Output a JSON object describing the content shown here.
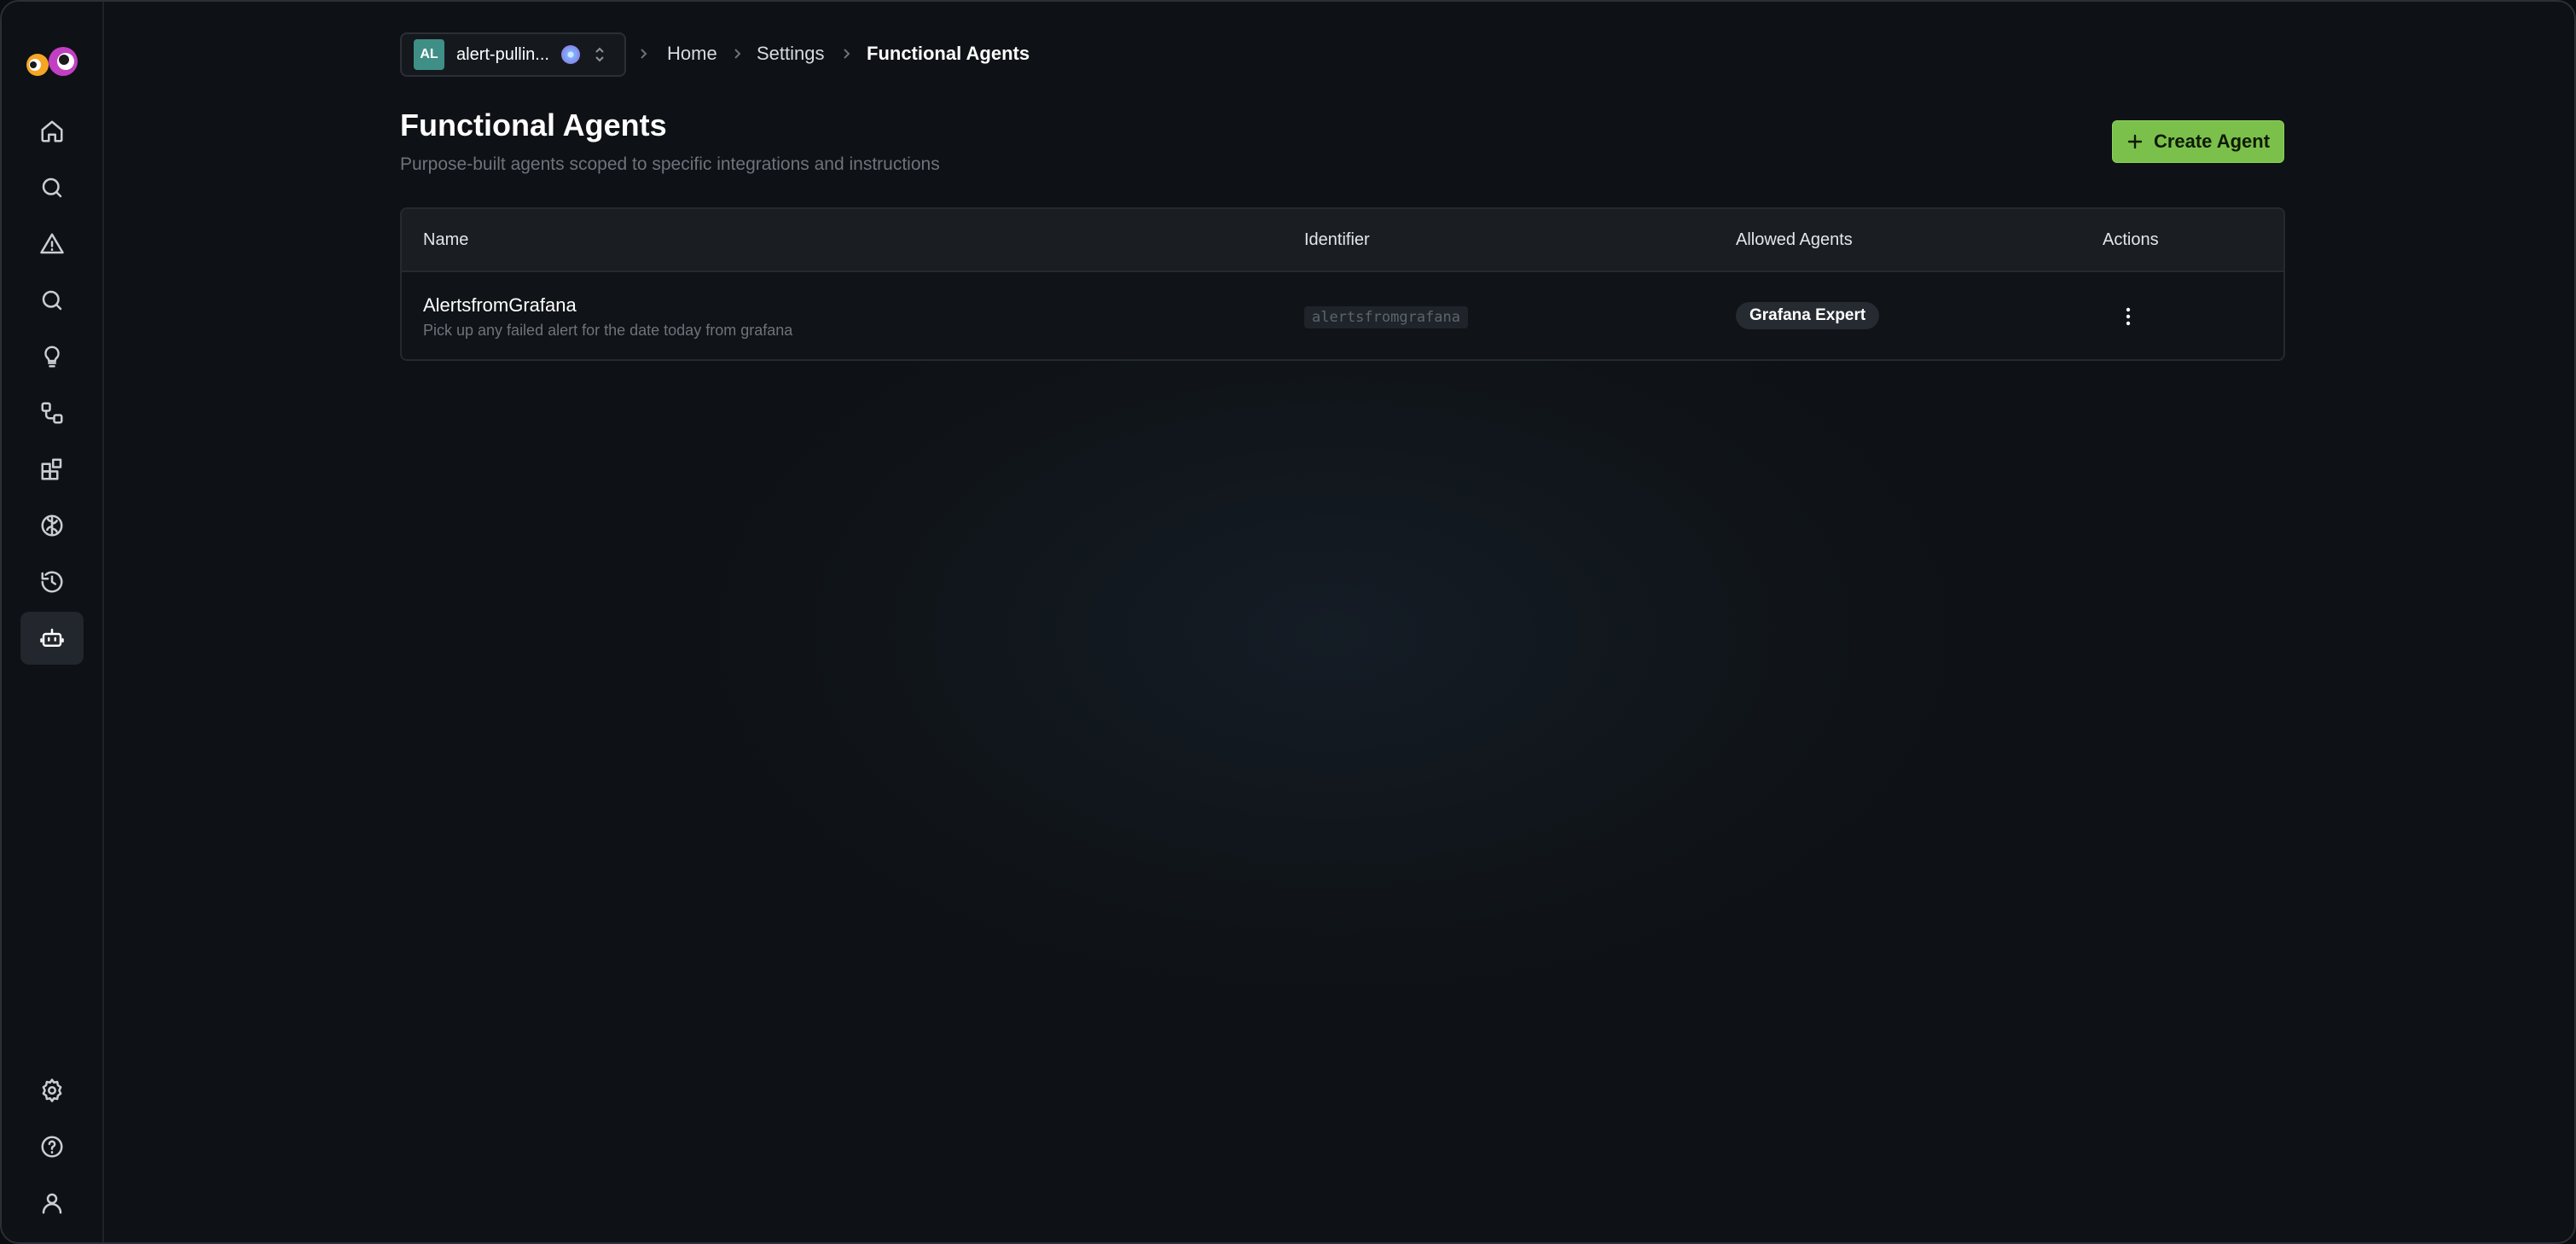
{
  "workspace": {
    "badge": "AL",
    "name": "alert-pullin..."
  },
  "breadcrumb": {
    "home": "Home",
    "settings": "Settings",
    "current": "Functional Agents"
  },
  "page": {
    "title": "Functional Agents",
    "subtitle": "Purpose-built agents scoped to specific integrations and instructions",
    "create_label": "Create Agent"
  },
  "table": {
    "headers": [
      "Name",
      "Identifier",
      "Allowed Agents",
      "Actions"
    ],
    "rows": [
      {
        "name": "AlertsfromGrafana",
        "description": "Pick up any failed alert for the date today from grafana",
        "identifier": "alertsfromgrafana",
        "allowed_agents": [
          "Grafana Expert"
        ]
      }
    ]
  },
  "sidebar": {
    "items": [
      "home-icon",
      "search-icon",
      "alert-triangle-icon",
      "search-icon",
      "lightbulb-icon",
      "workflow-icon",
      "integrations-icon",
      "brain-icon",
      "history-icon",
      "bot-icon"
    ],
    "active": "bot-icon",
    "bottom": [
      "gear-icon",
      "help-icon",
      "user-icon"
    ]
  },
  "colors": {
    "accent": "#7bc04b",
    "background": "#0f1317",
    "badge": "#3f8f86"
  }
}
